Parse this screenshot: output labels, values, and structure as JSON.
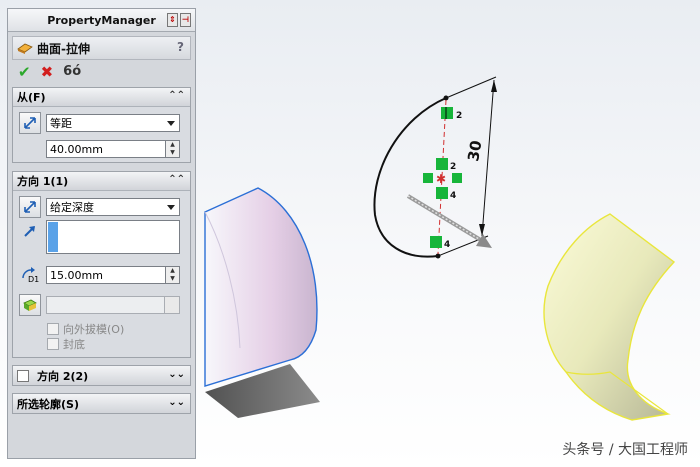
{
  "panel": {
    "title": "PropertyManager",
    "feature_title": "曲面-拉伸",
    "help": "?",
    "actions": {
      "ok": "✔",
      "cancel": "✖",
      "preview": "6ó"
    }
  },
  "from_section": {
    "header": "从(F)",
    "condition": "等距",
    "offset_value": "40.00mm"
  },
  "direction1": {
    "header": "方向 1(1)",
    "end_condition": "给定深度",
    "depth_label": "D1",
    "depth_value": "15.00mm",
    "draft_label": "向外拔模(O)",
    "cap_label": "封底"
  },
  "direction2": {
    "header": "方向 2(2)"
  },
  "contours": {
    "header": "所选轮廓(S)"
  },
  "sketch": {
    "dimension": "30",
    "relation_labels": [
      "2",
      "2",
      "4",
      "4"
    ]
  },
  "watermark": "头条号 / 大国工程师",
  "colors": {
    "accent_blue": "#5aa2e8",
    "relation_green": "#17b53a",
    "surface_yellow": "#f1f08f"
  }
}
